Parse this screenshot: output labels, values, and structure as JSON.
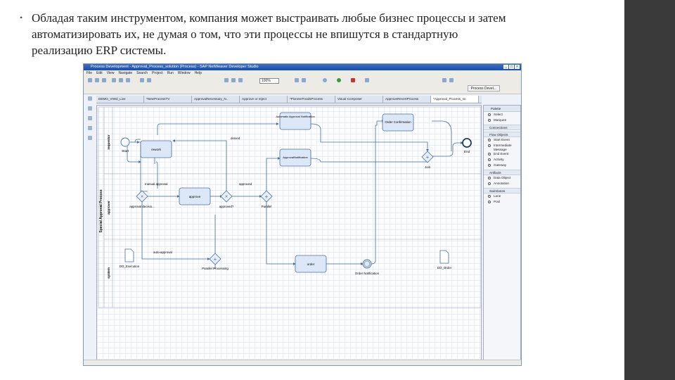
{
  "slide": {
    "bullet": "•",
    "text": "Обладая таким инструментом, компания может выстраивать любые бизнес процессы и затем автоматизировать их, не думая о том, что эти процессы не впишутся в стандартную реализацию ERP системы."
  },
  "window": {
    "title": "Process Development - Approval_Process_solution (Process) - SAP NetWeaver Developer Studio",
    "menu": [
      "File",
      "Edit",
      "View",
      "Navigate",
      "Search",
      "Project",
      "Run",
      "Window",
      "Help"
    ],
    "zoom": "100%",
    "perspective": "Process Devel..."
  },
  "tabs": [
    "DEMO_VIWd_Live",
    "*NewProcessTV",
    "ApprovalNecessary_N..",
    "Approve or reject",
    "*PioneerFoodsProcess",
    "Visual Composer",
    "ApproveRevertProcess",
    "*Approval_Process_so"
  ],
  "diagram": {
    "pool": "Special Approval Process",
    "lanes": [
      "requestor",
      "approver",
      "system"
    ],
    "start": "Start",
    "end": "End",
    "tasks": {
      "rework": "rework",
      "approve": "approve",
      "auto_notify": "Automatic Approval Notification",
      "approval_notify": "ApprovalNotification",
      "order": "order",
      "order_confirm": "Order Confirmation"
    },
    "gateways": {
      "approval_decision": "approval decisio...",
      "approved_q": "approved?",
      "parallel": "Parallel",
      "parallel_processing": "Parallel Processing",
      "join": "Join"
    },
    "flows": {
      "manual": "manual approval",
      "auto": "auto-approval",
      "denied": "denied",
      "approved": "approved"
    },
    "objects": {
      "do_exec": "DO_Execution",
      "do_order": "DO_Order"
    },
    "event_notify": "Order Notification"
  },
  "palette": {
    "title": "Palette",
    "tools": [
      "Select",
      "Marquee"
    ],
    "sections": [
      {
        "name": "Connections",
        "items": []
      },
      {
        "name": "Flow Objects",
        "items": [
          "Start Event",
          "Intermediate Message",
          "End Event",
          "Activity",
          "Gateway"
        ]
      },
      {
        "name": "Artifacts",
        "items": [
          "Data Object",
          "Annotation"
        ]
      },
      {
        "name": "Swimlanes",
        "items": [
          "Lane",
          "Pool"
        ]
      }
    ]
  },
  "colors": {
    "task_fill": "#dce8f7",
    "task_stroke": "#4a6d99",
    "flow": "#4a6d99",
    "lane_line": "#9aaabc",
    "titlebar": "#2a5cb5",
    "right_bar": "#3a3a3a"
  }
}
